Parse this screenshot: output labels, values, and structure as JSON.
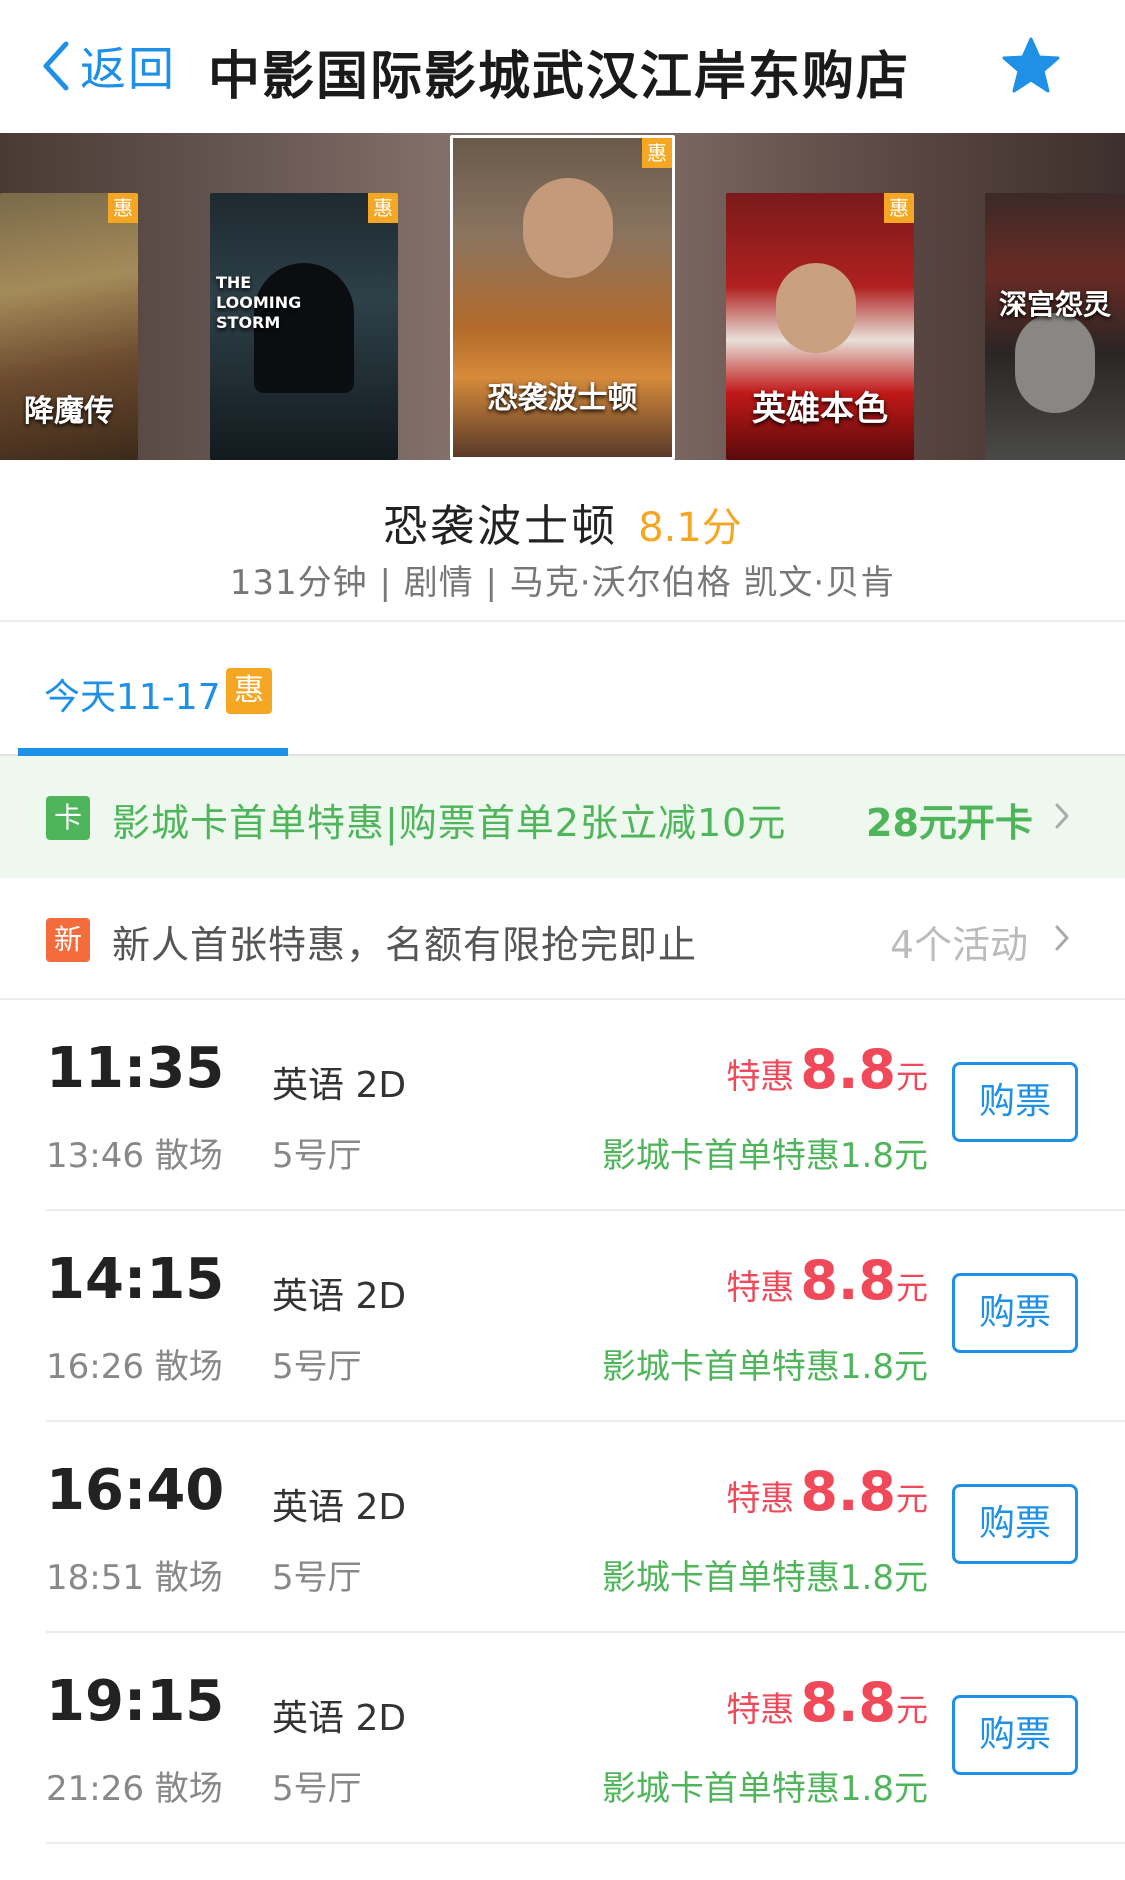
{
  "nav": {
    "back_label": "返回",
    "title": "中影国际影城武汉江岸东购店",
    "favorite_icon": "star-icon",
    "accent_color": "#1e90e6"
  },
  "carousel": {
    "badge": "惠",
    "posters": [
      {
        "caption": "降魔传",
        "has_badge": true
      },
      {
        "caption": "THE LOOMING STORM",
        "has_badge": true
      },
      {
        "caption": "恐袭波士顿",
        "has_badge": true,
        "selected": true
      },
      {
        "caption": "英雄本色",
        "has_badge": true
      },
      {
        "caption": "深宫怨灵",
        "has_badge": false
      }
    ]
  },
  "movie": {
    "title": "恐袭波士顿",
    "score": "8.1分",
    "meta": "131分钟 | 剧情 | 马克·沃尔伯格 凯文·贝肯"
  },
  "date_tabs": [
    {
      "label": "今天11-17",
      "badge": "惠",
      "active": true
    }
  ],
  "card_promo": {
    "icon_text": "卡",
    "text": "影城卡首单特惠|购票首单2张立减10元",
    "action": "28元开卡"
  },
  "new_promo": {
    "icon_text": "新",
    "text": "新人首张特惠，名额有限抢完即止",
    "action": "4个活动"
  },
  "showtimes": [
    {
      "start": "11:35",
      "end": "13:46 散场",
      "lang": "英语 2D",
      "hall": "5号厅",
      "price_label": "特惠",
      "price": "8.8",
      "unit": "元",
      "discount": "影城卡首单特惠1.8元",
      "buy": "购票"
    },
    {
      "start": "14:15",
      "end": "16:26 散场",
      "lang": "英语 2D",
      "hall": "5号厅",
      "price_label": "特惠",
      "price": "8.8",
      "unit": "元",
      "discount": "影城卡首单特惠1.8元",
      "buy": "购票"
    },
    {
      "start": "16:40",
      "end": "18:51 散场",
      "lang": "英语 2D",
      "hall": "5号厅",
      "price_label": "特惠",
      "price": "8.8",
      "unit": "元",
      "discount": "影城卡首单特惠1.8元",
      "buy": "购票"
    },
    {
      "start": "19:15",
      "end": "21:26 散场",
      "lang": "英语 2D",
      "hall": "5号厅",
      "price_label": "特惠",
      "price": "8.8",
      "unit": "元",
      "discount": "影城卡首单特惠1.8元",
      "buy": "购票"
    }
  ]
}
